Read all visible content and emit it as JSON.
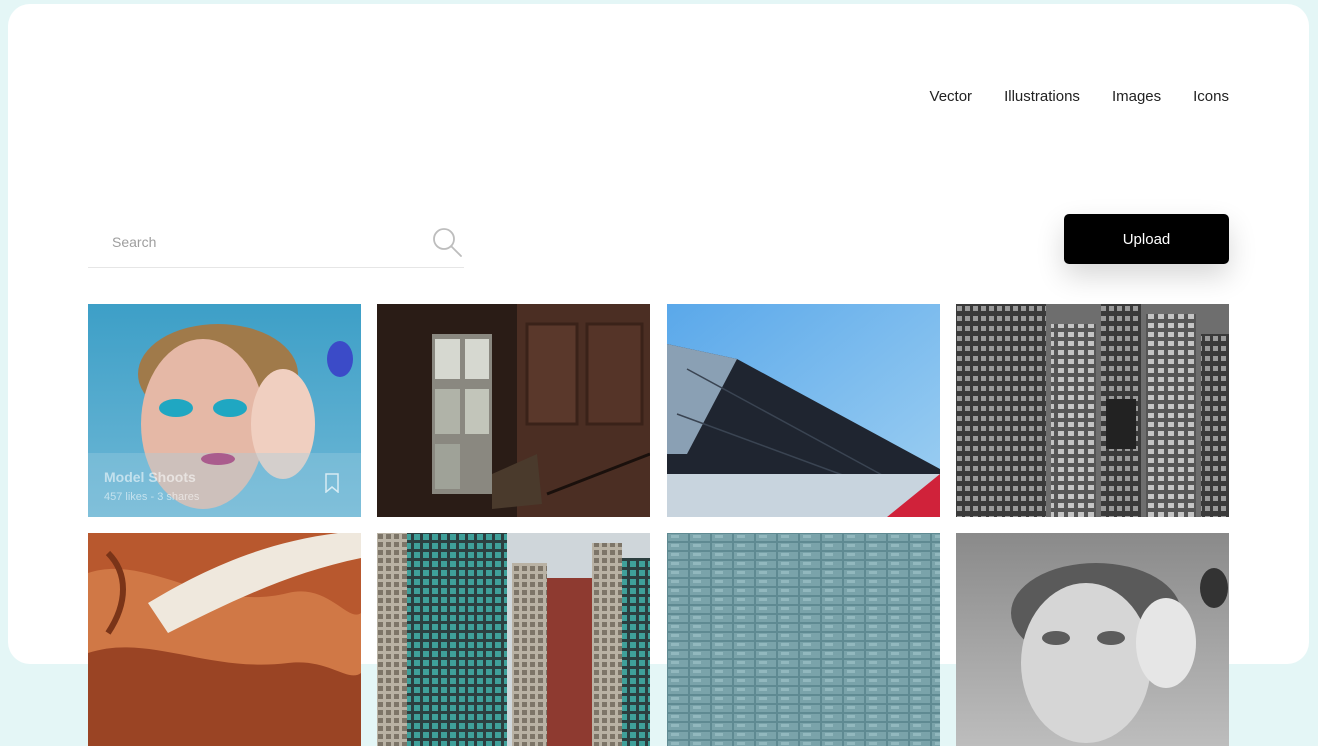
{
  "nav": {
    "items": [
      {
        "label": "Vector"
      },
      {
        "label": "Illustrations"
      },
      {
        "label": "Images"
      },
      {
        "label": "Icons"
      }
    ]
  },
  "search": {
    "placeholder": "Search",
    "value": ""
  },
  "upload": {
    "label": "Upload"
  },
  "gallery": {
    "featured": {
      "title": "Model Shoots",
      "meta": "457 likes - 3 shares"
    },
    "tiles": [
      {
        "icon": "photo-makeup-portrait"
      },
      {
        "icon": "photo-old-window"
      },
      {
        "icon": "photo-building-roof-sky"
      },
      {
        "icon": "photo-bw-skyscrapers"
      },
      {
        "icon": "photo-aerial-desert"
      },
      {
        "icon": "photo-city-towers"
      },
      {
        "icon": "photo-stone-wall"
      },
      {
        "icon": "photo-bw-portrait"
      }
    ]
  }
}
